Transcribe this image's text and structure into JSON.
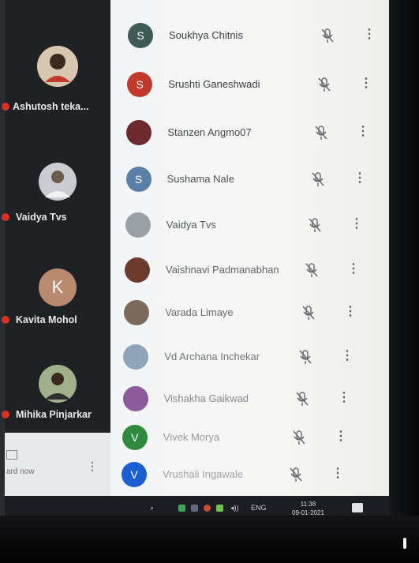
{
  "left_panel": {
    "tiles": [
      {
        "name": "Ashutosh teka...",
        "avatar_type": "photo",
        "avatar_color": "#b5552e"
      },
      {
        "name": "Vaidya Tvs",
        "avatar_type": "photo",
        "avatar_color": "#8a8f98"
      },
      {
        "name": "Kavita Mohol",
        "avatar_type": "letter",
        "avatar_letter": "K",
        "avatar_color": "#b98a6f"
      },
      {
        "name": "Mihika Pinjarkar",
        "avatar_type": "photo",
        "avatar_color": "#5a6a52"
      }
    ],
    "present_label": "ard now"
  },
  "participants": [
    {
      "name": "Soukhya Chitnis",
      "avatar_letter": "S",
      "avatar_color": "#3e5c55",
      "muted": true
    },
    {
      "name": "Srushti Ganeshwadi",
      "avatar_letter": "S",
      "avatar_color": "#c0392b",
      "muted": true
    },
    {
      "name": "Stanzen Angmo07",
      "avatar_letter": "",
      "avatar_color": "#6e2a2f",
      "muted": true
    },
    {
      "name": "Sushama Nale",
      "avatar_letter": "S",
      "avatar_color": "#5a7fa8",
      "muted": true
    },
    {
      "name": "Vaidya Tvs",
      "avatar_letter": "",
      "avatar_color": "#9aa0a6",
      "muted": true
    },
    {
      "name": "Vaishnavi Padmanabhan",
      "avatar_letter": "",
      "avatar_color": "#6b3b2e",
      "muted": true
    },
    {
      "name": "Varada Limaye",
      "avatar_letter": "",
      "avatar_color": "#7c6a5c",
      "muted": true
    },
    {
      "name": "Vd Archana Inchekar",
      "avatar_letter": "",
      "avatar_color": "#8fa4b8",
      "muted": true
    },
    {
      "name": "Vishakha Gaikwad",
      "avatar_letter": "",
      "avatar_color": "#8d5a9c",
      "muted": true
    },
    {
      "name": "Vivek Morya",
      "avatar_letter": "V",
      "avatar_color": "#2e8b3e",
      "muted": true
    },
    {
      "name": "Vrushali Ingawale",
      "avatar_letter": "V",
      "avatar_color": "#1a5fd1",
      "muted": true
    }
  ],
  "taskbar": {
    "language": "ENG",
    "time": "11:38",
    "date": "09-01-2021"
  }
}
